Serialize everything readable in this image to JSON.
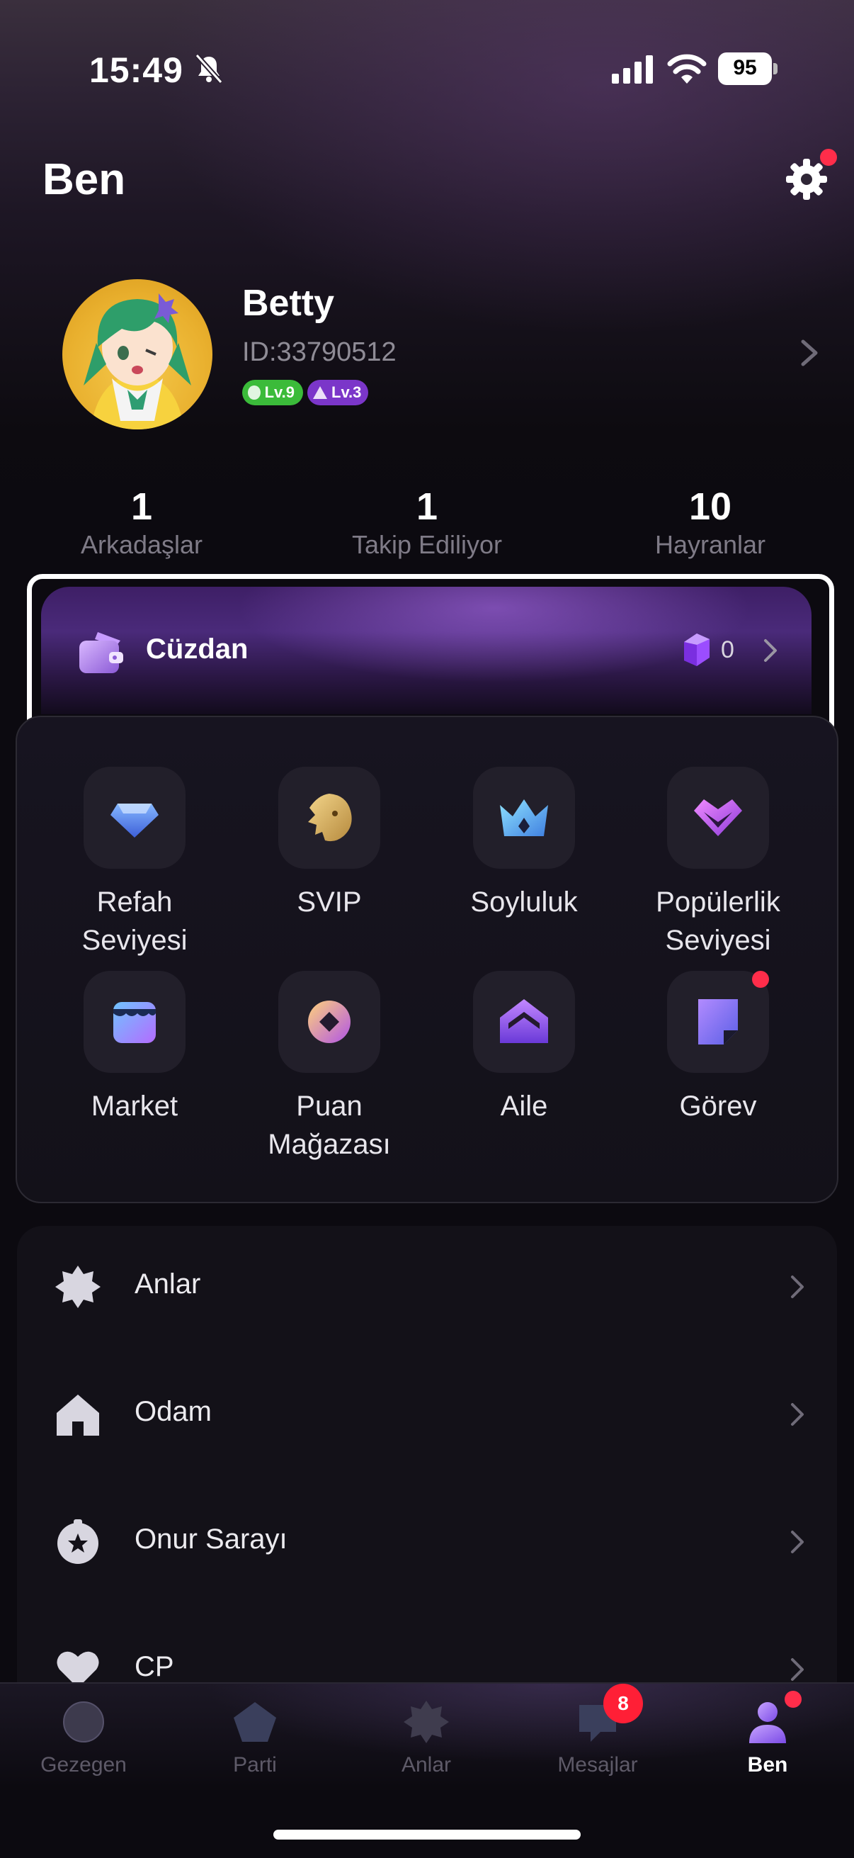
{
  "status_bar": {
    "time": "15:49",
    "battery": "95"
  },
  "header": {
    "title": "Ben"
  },
  "profile": {
    "name": "Betty",
    "id": "ID:33790512",
    "badge_wealth": "Lv.9",
    "badge_charm": "Lv.3"
  },
  "stats": [
    {
      "value": "1",
      "label": "Arkadaşlar"
    },
    {
      "value": "1",
      "label": "Takip Ediliyor"
    },
    {
      "value": "10",
      "label": "Hayranlar"
    }
  ],
  "wallet": {
    "label": "Cüzdan",
    "value": "0"
  },
  "features": [
    {
      "label": "Refah Seviyesi",
      "icon": "diamond-icon"
    },
    {
      "label": "SVIP",
      "icon": "lion-icon"
    },
    {
      "label": "Soyluluk",
      "icon": "crown-icon"
    },
    {
      "label": "Popülerlik Seviyesi",
      "icon": "heart-diamond-icon"
    },
    {
      "label": "Market",
      "icon": "shop-icon"
    },
    {
      "label": "Puan Mağazası",
      "icon": "coin-icon"
    },
    {
      "label": "Aile",
      "icon": "family-house-icon"
    },
    {
      "label": "Görev",
      "icon": "task-note-icon"
    }
  ],
  "menu": [
    {
      "label": "Anlar",
      "icon": "star-badge-icon"
    },
    {
      "label": "Odam",
      "icon": "home-icon"
    },
    {
      "label": "Onur Sarayı",
      "icon": "honor-star-icon"
    },
    {
      "label": "CP",
      "icon": "heart-icon"
    }
  ],
  "tabs": [
    {
      "label": "Gezegen",
      "icon": "planet-icon"
    },
    {
      "label": "Parti",
      "icon": "party-icon"
    },
    {
      "label": "Anlar",
      "icon": "moments-icon"
    },
    {
      "label": "Mesajlar",
      "icon": "message-icon",
      "badge": "8"
    },
    {
      "label": "Ben",
      "icon": "profile-icon"
    }
  ],
  "colors": {
    "accent": "#7b36c9",
    "notification": "#ff2d4a",
    "active_tab": "#ffffff"
  }
}
